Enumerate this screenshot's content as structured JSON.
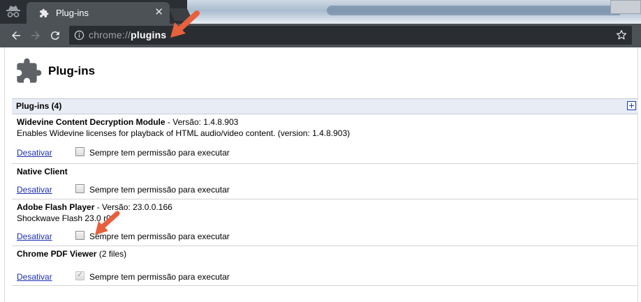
{
  "browser": {
    "tab": {
      "title": "Plug-ins"
    },
    "address": {
      "scheme": "chrome://",
      "host": "plugins"
    }
  },
  "page": {
    "title": "Plug-ins"
  },
  "section": {
    "title": "Plug-ins (4)"
  },
  "plugins": [
    {
      "name": "Widevine Content Decryption Module",
      "version": "- Versão: 1.4.8.903",
      "description": "Enables Widevine licenses for playback of HTML audio/video content. (version: 1.4.8.903)",
      "disable_label": "Desativar",
      "always_allow_label": "Sempre tem permissão para executar",
      "always_allow": false
    },
    {
      "name": "Native Client",
      "version": "",
      "description": "",
      "disable_label": "Desativar",
      "always_allow_label": "Sempre tem permissão para executar",
      "always_allow": false
    },
    {
      "name": "Adobe Flash Player",
      "version": "- Versão: 23.0.0.166",
      "description": "Shockwave Flash 23.0 r0",
      "disable_label": "Desativar",
      "always_allow_label": "Sempre tem permissão para executar",
      "always_allow": false
    },
    {
      "name": "Chrome PDF Viewer",
      "version": "(2 files)",
      "description": "",
      "disable_label": "Desativar",
      "always_allow_label": "Sempre tem permissão para executar",
      "always_allow": true
    }
  ],
  "colors": {
    "annotation_arrow": "#e8603c",
    "link": "#1e2fb4",
    "header_bg": "#e8ecf5"
  },
  "icons": [
    "incognito-icon",
    "puzzle-icon",
    "close-icon",
    "back-icon",
    "forward-icon",
    "reload-icon",
    "info-icon",
    "star-icon",
    "expand-icon",
    "arrow-icon"
  ]
}
